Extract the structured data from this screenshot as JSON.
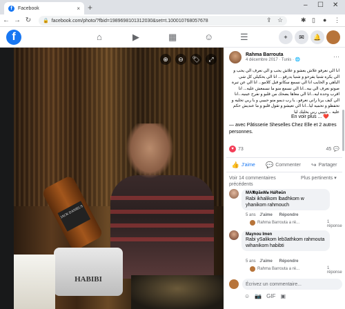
{
  "browser": {
    "tab_title": "Facebook",
    "tab_close": "×",
    "new_tab": "+",
    "url": "facebook.com/photo/?fbid=1989698101312030&set=t.100010768057678",
    "lock": "🔒",
    "win_min": "–",
    "win_max": "☐",
    "win_close": "✕"
  },
  "fbnav": {
    "logo": "f",
    "icons": [
      "⌂",
      "▶",
      "▦",
      "☺",
      "☰"
    ],
    "plus": "+",
    "messenger": "✉",
    "bell": "🔔"
  },
  "viewer": {
    "zoom_in": "⊕",
    "zoom_out": "⊖",
    "tag": "🏷",
    "fullscreen": "⤢",
    "bucket_text": "HABIBI",
    "bottle_text": "JACK DANIEL'S"
  },
  "post": {
    "author": "Rahma Barrouta",
    "date": "4 décembre 2017 · Tunis · 🌐",
    "more": "···",
    "text": "انا الي نعرفو علاش يعشو و علاش يحب و الي نعرف الي يحب و الي يكره شنيا يفرحو و شنيا يدرقو ... انا الي يحكيلي كل شي الباهي و الخايب انا الي نسمع سكاتو قبل كلامو... انا الي عن تبرة صوتو نعرف الي بيه...انا الي نسمع منو ما نسمعش عليه... انا اقرب وحدة ليه...انا الي معاها يضحك من قلبو و نفرح عينيه...انا الي كيف يرتا راني نعرفو.. يا رب ديمو منو حبيبي و يا ربي تخليه و تحفظو و تحميه ليا...انا الي تعيشو و تقول قلبو و ما عنديش حكم عليه .. حبيبي ربي يخليك ليا",
    "en_plus": "En voir plus ...",
    "heart": "❤️",
    "with_text": "— avec Pâtisserie Sheselles Chez Elle et 2 autres personnes.",
    "reactions_count": "73",
    "comments_count": "45",
    "like_label": "J'aime",
    "comment_label": "Commenter",
    "share_label": "Partager",
    "more_comments": "Voir 14 commentaires précédents",
    "sort_label": "Plus pertinents ▾"
  },
  "comments": [
    {
      "author": "MA𝕽ψã𝖗ιM𝖆 HáRɵŭn",
      "text": "Rabi ikhalikom lbadhkom w yhanikom rahmouch",
      "time": "5 ans",
      "like": "J'aime",
      "reply": "Répondre",
      "reply_author": "Rahma Barrouta a ré...",
      "reply_count": "1 réponse"
    },
    {
      "author": "Maynou Imen",
      "text": "Rabi ySalikom leb3athkom rahmouta wihanikom habibti",
      "time": "5 ans",
      "like": "J'aime",
      "reply": "Répondre",
      "reply_author": "Rahma Barrouta a ré...",
      "reply_count": "1 réponse"
    }
  ],
  "composer": {
    "placeholder": "Écrivez un commentaire...",
    "icons": [
      "☺",
      "📷",
      "GIF",
      "▣"
    ]
  }
}
